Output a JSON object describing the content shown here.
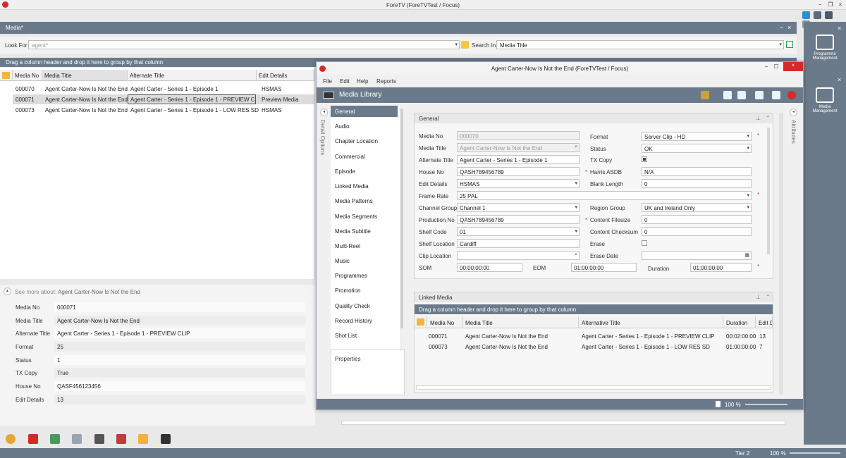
{
  "app": {
    "title": "ForeTV (ForeTVTest / Focus)"
  },
  "panel": {
    "title": "Media*",
    "minimize": "−",
    "close": "×"
  },
  "search": {
    "look_for_label": "Look For",
    "look_for_value": "agent*",
    "search_in_label": "Search In",
    "search_in_value": "Media Title"
  },
  "group_hint": "Drag a column header and drop it here to group by that column",
  "grid": {
    "columns": [
      "Media No",
      "Media Title",
      "Alternate Title",
      "Edit Details"
    ],
    "rows": [
      [
        "000070",
        "Agent Carter-Now Is Not the End",
        "Agent Carter - Series 1 - Episode 1",
        "HSMAS"
      ],
      [
        "000071",
        "Agent Carter-Now Is Not the End",
        "Agent Carter - Series 1 - Episode 1  - PREVIEW CLIP",
        "Preview Media"
      ],
      [
        "000073",
        "Agent Carter-Now Is Not the End",
        "Agent Carter - Series 1 - Episode 1 - LOW RES SD",
        "HSMAS"
      ]
    ]
  },
  "see_more": {
    "label": "See more about:",
    "title": "Agent Carter-Now Is Not the End",
    "fields": [
      {
        "label": "Media No",
        "value": "000071"
      },
      {
        "label": "Media Title",
        "value": "Agent Carter-Now Is Not the End"
      },
      {
        "label": "Alternate Title",
        "value": "Agent Carter - Series 1 - Episode 1  - PREVIEW CLIP"
      },
      {
        "label": "Format",
        "value": "25"
      },
      {
        "label": "Status",
        "value": "1"
      },
      {
        "label": "TX Copy",
        "value": "True"
      },
      {
        "label": "House No",
        "value": "QASF456123456"
      },
      {
        "label": "Edit Details",
        "value": "13"
      }
    ]
  },
  "right_bar": {
    "item1": "Programme Management",
    "item2": "Media Management"
  },
  "status": {
    "tier": "Tier 2",
    "zoom": "100 %"
  },
  "child": {
    "title": "Agent Carter-Now Is Not the End (ForeTVTest / Focus)",
    "menu": [
      "File",
      "Edit",
      "Help",
      "Reports"
    ],
    "header": "Media Library",
    "detail_options": "Detail Options",
    "attributes": "Attributes",
    "nav": [
      "General",
      "Audio",
      "Chapter Location",
      "Commercial",
      "Episode",
      "Linked Media",
      "Media Patterns",
      "Media Segments",
      "Media Subtitle",
      "Multi-Reel",
      "Music",
      "Programmes",
      "Promotion",
      "Quality Check",
      "Record History",
      "Shot List"
    ],
    "properties": "Properties",
    "general": {
      "title": "General",
      "media_no_label": "Media No",
      "media_no": "000070",
      "media_title_label": "Media Title",
      "media_title": "Agent Carter-Now Is Not the End",
      "alt_title_label": "Alternate Title",
      "alt_title": "Agent Carter - Series 1 - Episode 1",
      "house_no_label": "House No",
      "house_no": "QASH789456789",
      "edit_details_label": "Edit Details",
      "edit_details": "HSMAS",
      "frame_rate_label": "Frame Rate",
      "frame_rate": "25 PAL",
      "channel_group_label": "Channel Group",
      "channel_group": "Channel 1",
      "production_no_label": "Production No",
      "production_no": "QASH789456789",
      "shelf_code_label": "Shelf Code",
      "shelf_code": "01",
      "shelf_location_label": "Shelf Location",
      "shelf_location": "Cardiff",
      "clip_location_label": "Clip Location",
      "clip_location": "",
      "som_label": "SOM",
      "som": "00:00:00:00",
      "eom_label": "EOM",
      "eom": "01:00:00:00",
      "duration_label": "Duration",
      "duration": "01:00:00:00",
      "format_label": "Format",
      "format": "Server Clip - HD",
      "status_label": "Status",
      "status": "OK",
      "tx_copy_label": "TX Copy",
      "harris_label": "Harris ASDB",
      "harris": "N/A",
      "blank_length_label": "Blank Length",
      "blank_length": "0",
      "region_group_label": "Region Group",
      "region_group": "UK and Ireland Only",
      "content_filesize_label": "Content Filesize",
      "content_filesize": "0",
      "content_checksum_label": "Content Checksum",
      "content_checksum": "0",
      "erase_label": "Erase",
      "erase_date_label": "Erase Date",
      "erase_date": ""
    },
    "linked": {
      "title": "Linked Media",
      "group_hint": "Drag a column header and drop it here to group by that column",
      "columns": [
        "Media No",
        "Media Title",
        "Alternative Title",
        "Duration",
        "Edit D"
      ],
      "rows": [
        [
          "000071",
          "Agent Carter-Now Is Not the End",
          "Agent Carter - Series 1 - Episode 1  - PREVIEW CLIP",
          "00:02:00:00",
          "13"
        ],
        [
          "000073",
          "Agent Carter-Now Is Not the End",
          "Agent Carter - Series 1 - Episode 1 - LOW RES SD",
          "01:00:00:00",
          "7"
        ]
      ]
    },
    "zoom": "100 %"
  },
  "colors": {
    "header": "#6b7a8a",
    "accent_red": "#d62a2a"
  }
}
